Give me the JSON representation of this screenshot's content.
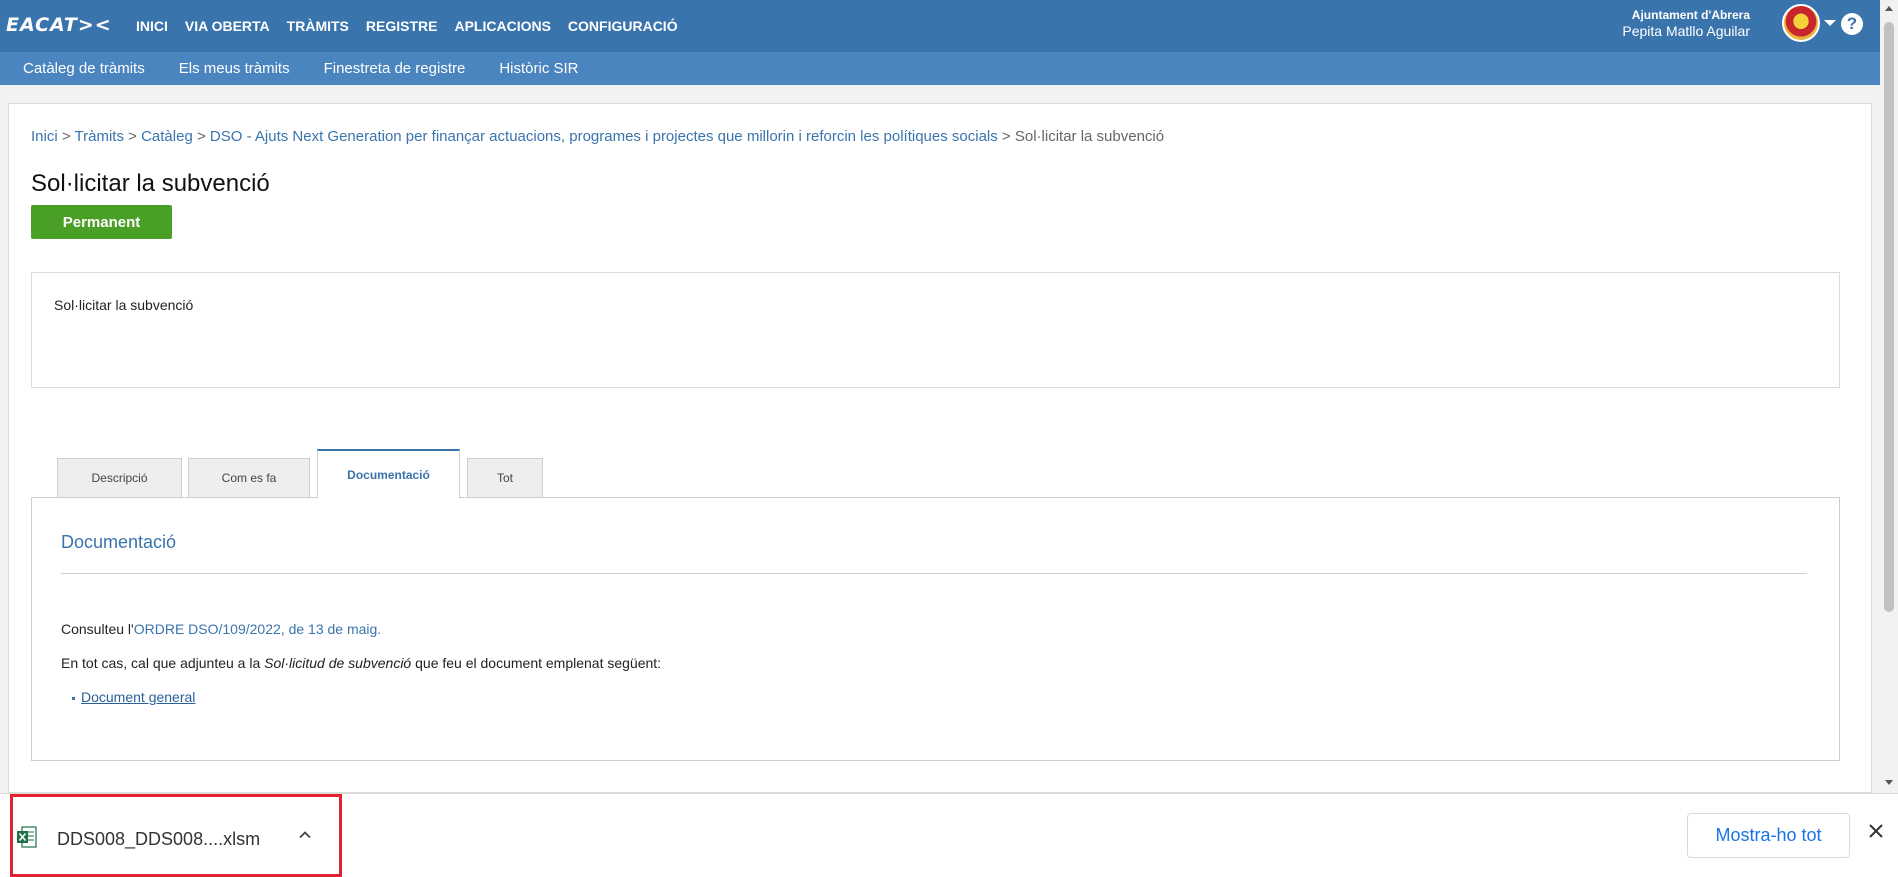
{
  "header": {
    "logo": "EACAT><",
    "nav": [
      "INICI",
      "VIA OBERTA",
      "TRÀMITS",
      "REGISTRE",
      "APLICACIONS",
      "CONFIGURACIÓ"
    ],
    "org": "Ajuntament d'Abrera",
    "user_name": "Pepita Matllo Aguilar",
    "help_icon": "?",
    "avatar_icon": "municipal-shield-icon"
  },
  "subnav": [
    "Catàleg de tràmits",
    "Els meus tràmits",
    "Finestreta de registre",
    "Històric SIR"
  ],
  "breadcrumb": {
    "items": [
      "Inici",
      "Tràmits",
      "Catàleg",
      "DSO - Ajuts Next Generation per finançar actuacions, programes i projectes que millorin i reforcin les polítiques socials"
    ],
    "separator": ">",
    "current": "Sol·licitar la subvenció"
  },
  "page": {
    "title": "Sol·licitar la subvenció",
    "badge": "Permanent",
    "summary": "Sol·licitar la subvenció"
  },
  "tabs": [
    {
      "label": "Descripció",
      "active": false
    },
    {
      "label": "Com es fa",
      "active": false
    },
    {
      "label": "Documentació",
      "active": true
    },
    {
      "label": "Tot",
      "active": false
    }
  ],
  "panel": {
    "heading": "Documentació",
    "p1_prefix": "Consulteu l'",
    "p1_link": "ORDRE DSO/109/2022, de 13 de maig.",
    "p2_prefix": "En tot cas, cal que adjunteu a la ",
    "p2_em": "Sol·licitud de subvenció",
    "p2_suffix": " que feu el document emplenat següent:",
    "list_link": "Document general"
  },
  "download": {
    "filename": "DDS008_DDS008....xlsm",
    "file_icon": "excel-file-icon",
    "show_all": "Mostra-ho tot"
  },
  "colors": {
    "primary": "#3a74ad",
    "subbar": "#4a85c0",
    "badge": "#4a9f27",
    "highlight": "#e3212f",
    "chrome_link": "#1a73e8"
  }
}
